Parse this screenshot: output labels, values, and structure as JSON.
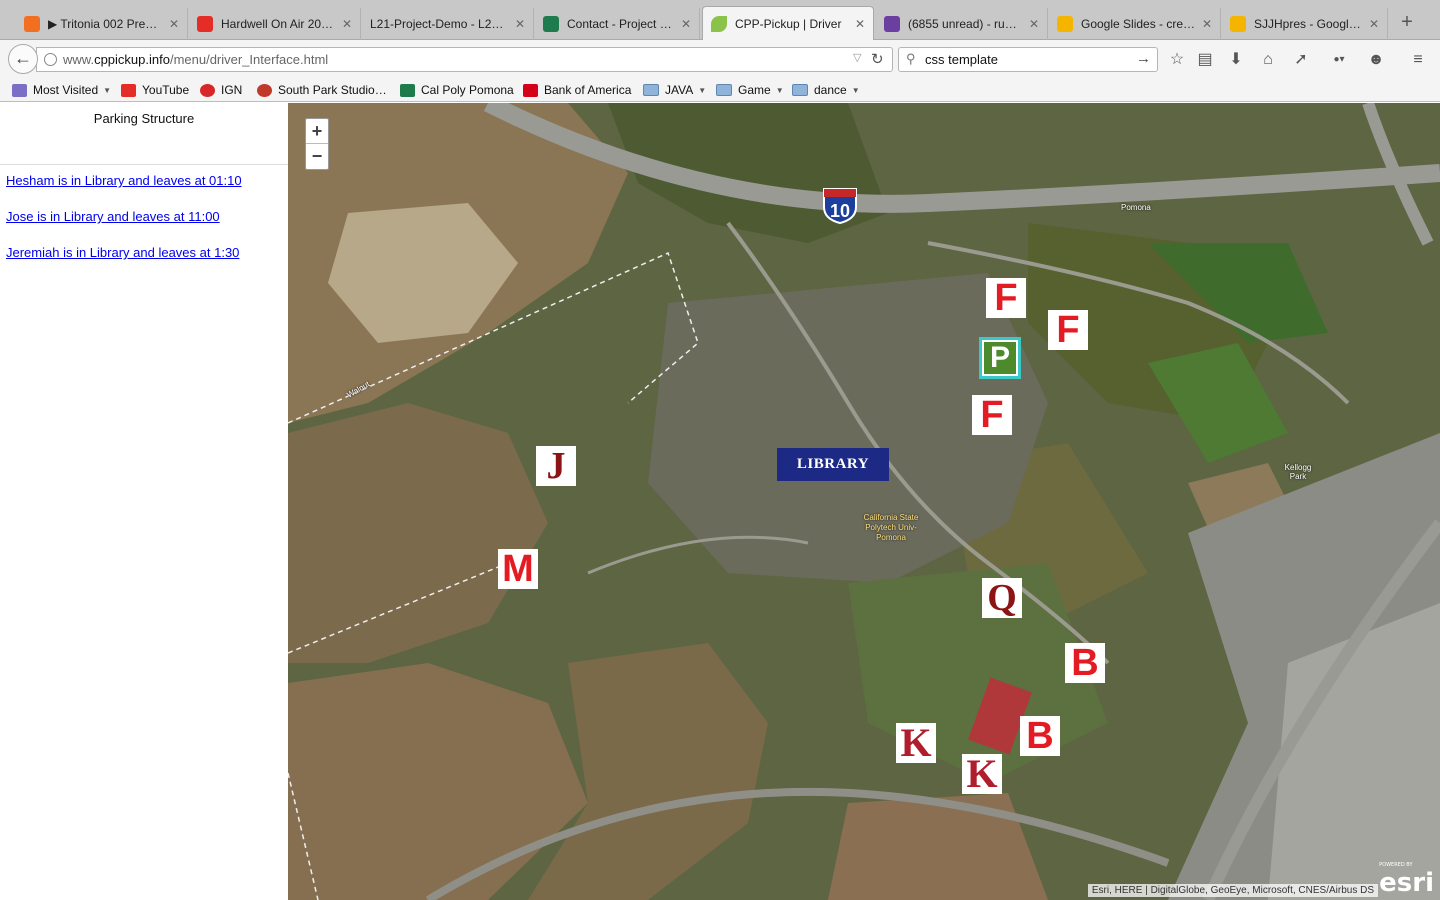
{
  "browser": {
    "tabs": [
      {
        "label": "▶ Tritonia 002 Previ…",
        "favicon_color": "#f26f21",
        "active": false
      },
      {
        "label": "Hardwell On Air 206…",
        "favicon_color": "#e52d27",
        "active": false
      },
      {
        "label": "L21-Project-Demo - L21…",
        "favicon_color": "#c8c8c8",
        "active": false
      },
      {
        "label": "Contact - Project Isis",
        "favicon_color": "#1e7b4b",
        "active": false
      },
      {
        "label": "CPP-Pickup | Driver",
        "favicon_color": "#8bc34a",
        "active": true
      },
      {
        "label": "(6855 unread) - rube…",
        "favicon_color": "#6b3fa0",
        "active": false
      },
      {
        "label": "Google Slides - crea…",
        "favicon_color": "#f4b400",
        "active": false
      },
      {
        "label": "SJJHpres - Google …",
        "favicon_color": "#f4b400",
        "active": false
      }
    ],
    "url_prefix": "www.",
    "url_domain": "cppickup.info",
    "url_path": "/menu/driver_Interface.html",
    "search_query": "css template",
    "bookmarks": [
      {
        "label": "Most Visited",
        "kind": "menu",
        "icon_color": "#7a6fc4"
      },
      {
        "label": "YouTube",
        "kind": "link",
        "icon_color": "#e52d27"
      },
      {
        "label": "IGN",
        "kind": "link",
        "icon_color": "#d62828"
      },
      {
        "label": "South Park Studio…",
        "kind": "link",
        "icon_color": "#c0392b"
      },
      {
        "label": "Cal Poly Pomona",
        "kind": "link",
        "icon_color": "#1e7b4b"
      },
      {
        "label": "Bank of America",
        "kind": "link",
        "icon_color": "#d4001a"
      },
      {
        "label": "JAVA",
        "kind": "folder"
      },
      {
        "label": "Game",
        "kind": "folder"
      },
      {
        "label": "dance",
        "kind": "folder"
      }
    ]
  },
  "sidebar": {
    "title": "Parking Structure",
    "drivers": [
      "Hesham is in Library and leaves at 01:10",
      "Jose is in Library and leaves at 11:00",
      "Jeremiah is in Library and leaves at 1:30"
    ]
  },
  "map": {
    "zoom_in": "+",
    "zoom_out": "−",
    "markers": [
      "F",
      "F",
      "P",
      "F",
      "J",
      "M",
      "Q",
      "B",
      "B",
      "K",
      "K"
    ],
    "library_label": "LIBRARY",
    "interstate_number": "10",
    "road_labels": [
      "Pomona",
      "Walnut",
      "Kellogg Park"
    ],
    "campus_label": "California State Polytech Univ-Pomona",
    "attribution": "Esri, HERE | DigitalGlobe, GeoEye, Microsoft, CNES/Airbus DS",
    "logo": "esri",
    "logo_caption": "POWERED BY"
  }
}
